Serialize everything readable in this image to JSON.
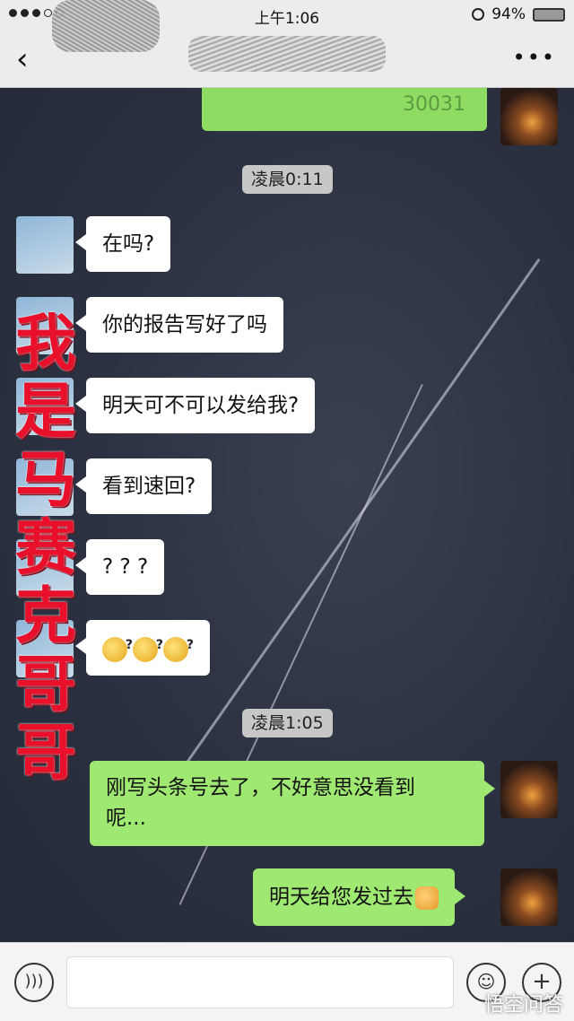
{
  "status_bar": {
    "time": "上午1:06",
    "battery": "94%"
  },
  "nav": {
    "back_label": "‹",
    "more_label": "•••"
  },
  "chat": {
    "redacted_text": "30031",
    "overlay_text": "我是马赛克哥哥",
    "timestamps": [
      "凌晨0:11",
      "凌晨1:05"
    ],
    "incoming_messages": [
      "在吗?",
      "你的报告写好了吗",
      "明天可不可以发给我?",
      "看到速回?",
      "? ? ?"
    ],
    "outgoing_messages": [
      "刚写头条号去了，不好意思没看到",
      "呢...",
      "明天给您发过去"
    ]
  },
  "input_bar": {
    "voice_icon": "voice-icon",
    "emoji_icon": "emoji-icon",
    "plus_icon": "plus-icon",
    "plus_label": "+"
  },
  "watermark": "悟空问答"
}
